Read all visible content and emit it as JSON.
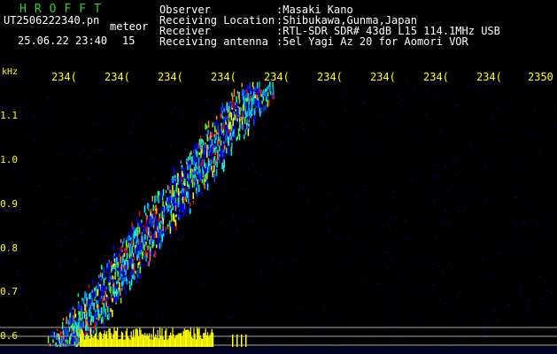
{
  "header": {
    "logo": "HROFFT",
    "filename": "UT2506222340.pn",
    "meteor_label": "meteor",
    "timestamp": "25.06.22 23:40",
    "count": "15",
    "fields": [
      {
        "label": "Observer",
        "value": ":Masaki Kano"
      },
      {
        "label": "Receiving Location",
        "value": ":Shibukawa,Gunma,Japan"
      },
      {
        "label": "Receiver",
        "value": ":RTL-SDR SDR# 43dB L15 114.1MHz USB"
      },
      {
        "label": "Receiving antenna",
        "value": ":5el Yagi Az 20 for Aomori VOR"
      }
    ]
  },
  "axis": {
    "y_unit": "kHz",
    "x_ticks": [
      "234(",
      "234(",
      "234(",
      "234(",
      "234(",
      "234(",
      "234(",
      "234(",
      "234(",
      "2350"
    ],
    "y_ticks": [
      "1.1",
      "1.0",
      "0.9",
      "0.8",
      "0.7",
      "0.6"
    ]
  },
  "colors": {
    "background": "#000000",
    "header_text": "#ffffff",
    "logo": "#33cc33",
    "axis_text": "#ffff00",
    "signal_low": "#0000ff",
    "signal_mid": "#00ffff",
    "signal_high": "#ff0000",
    "noise_bar": "#ffff00",
    "guide_line": "#aaaaaa"
  }
}
